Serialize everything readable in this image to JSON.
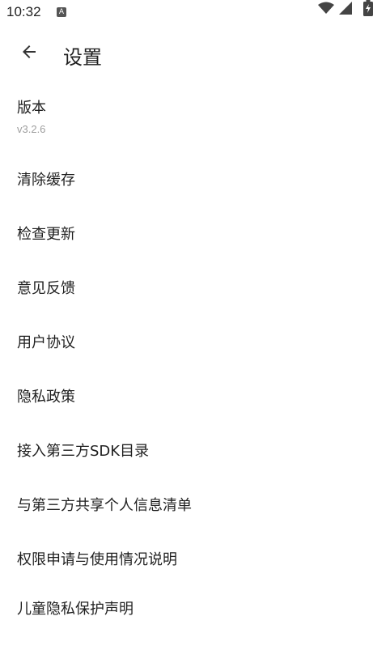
{
  "status_bar": {
    "time": "10:32",
    "notification_icon": "A",
    "icons": [
      "wifi-icon",
      "signal-icon",
      "battery-icon"
    ]
  },
  "toolbar": {
    "back_icon": "arrow-back-icon",
    "title": "设置"
  },
  "settings": {
    "version": {
      "label": "版本",
      "value": "v3.2.6"
    },
    "items": [
      {
        "label": "清除缓存"
      },
      {
        "label": "检查更新"
      },
      {
        "label": "意见反馈"
      },
      {
        "label": "用户协议"
      },
      {
        "label": "隐私政策"
      },
      {
        "label": "接入第三方SDK目录"
      },
      {
        "label": "与第三方共享个人信息清单"
      },
      {
        "label": "权限申请与使用情况说明"
      },
      {
        "label": "儿童隐私保护声明"
      }
    ]
  },
  "colors": {
    "background": "#ffffff",
    "text_primary": "#1f1f1f",
    "text_secondary": "#9e9e9e"
  }
}
